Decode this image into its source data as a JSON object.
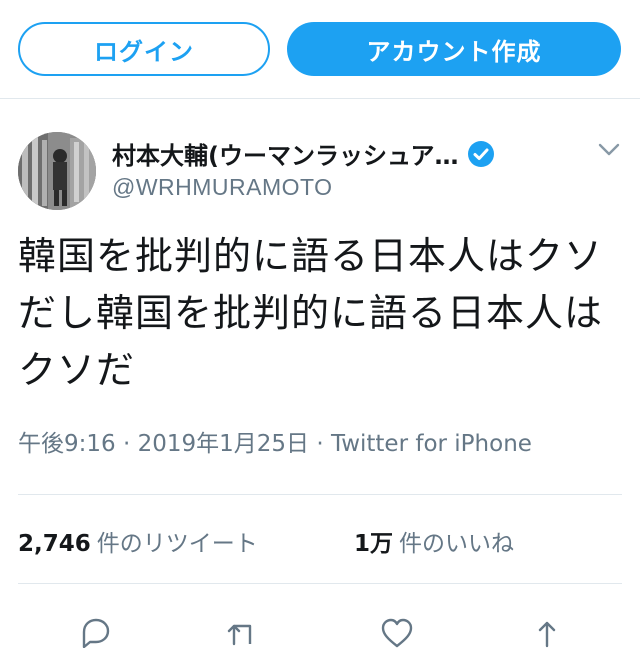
{
  "header": {
    "login_label": "ログイン",
    "signup_label": "アカウント作成"
  },
  "tweet": {
    "display_name": "村本大輔(ウーマンラッシュア…",
    "handle": "@WRHMURAMOTO",
    "verified": true,
    "text": "韓国を批判的に語る日本人はクソだし韓国を批判的に語る日本人はクソだ",
    "timestamp": "午後9:16 · 2019年1月25日 · Twitter for iPhone"
  },
  "stats": {
    "retweets_count": "2,746",
    "retweets_label": "件のリツイート",
    "likes_count": "1万",
    "likes_label": "件のいいね"
  },
  "actions": {
    "icons": [
      "reply-icon",
      "retweet-icon",
      "like-icon",
      "share-icon"
    ]
  },
  "colors": {
    "accent": "#1da1f2",
    "text": "#14171a",
    "secondary": "#657786",
    "divider": "#e1e8ed"
  }
}
